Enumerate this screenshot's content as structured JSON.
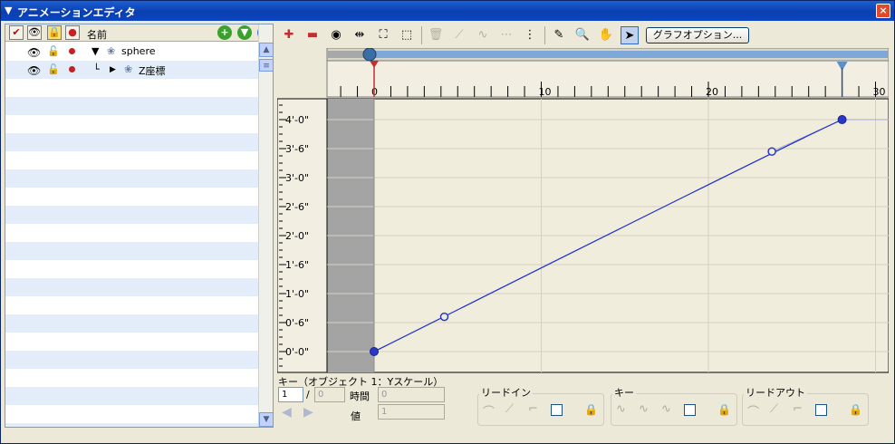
{
  "window": {
    "title": "アニメーションエディタ",
    "close": "×",
    "collapse": "▼"
  },
  "outliner": {
    "header": {
      "check_icon": "✔",
      "eye_icon": "👁",
      "lock_icon": "🔒",
      "record_icon": "●",
      "name_label": "名前",
      "add": "+",
      "down": "▼",
      "collapse": "«"
    },
    "rows": [
      {
        "label": "sphere",
        "expander": "▼",
        "icon": "❀"
      },
      {
        "label": "Z座標",
        "expander": "▶",
        "icon": "❀",
        "branch": "└"
      }
    ]
  },
  "toolbar": {
    "graph_options_label": "グラフオプション..."
  },
  "timeline": {
    "ruler_labels": [
      "0",
      "10",
      "20",
      "30"
    ],
    "current_frame": 0,
    "end_marker_frame": 28
  },
  "chart_data": {
    "type": "line",
    "x_unit": "frame",
    "y_tick_labels": [
      "4'-0\"",
      "3'-6\"",
      "3'-0\"",
      "2'-6\"",
      "2'-0\"",
      "1'-6\"",
      "1'-0\"",
      "0'-6\"",
      "0'-0\""
    ],
    "keys": [
      {
        "frame": 0,
        "value": 0,
        "kind": "key"
      },
      {
        "frame": 4.2,
        "value": 0.6,
        "kind": "handle"
      },
      {
        "frame": 23.8,
        "value": 3.45,
        "kind": "handle"
      },
      {
        "frame": 28,
        "value": 4.0,
        "kind": "key"
      }
    ],
    "xlim": [
      -2.8,
      31
    ],
    "ylim": [
      -0.3,
      4.45
    ]
  },
  "keypanel": {
    "title": "キー（オブジェクト 1：Yスケール）",
    "key_index": "1",
    "key_total": "0",
    "slash": "/",
    "time_label": "時間",
    "time_value": "0",
    "value_label": "値",
    "value_value": "1",
    "leadin_label": "リードイン",
    "key_label": "キー",
    "leadout_label": "リードアウト"
  }
}
